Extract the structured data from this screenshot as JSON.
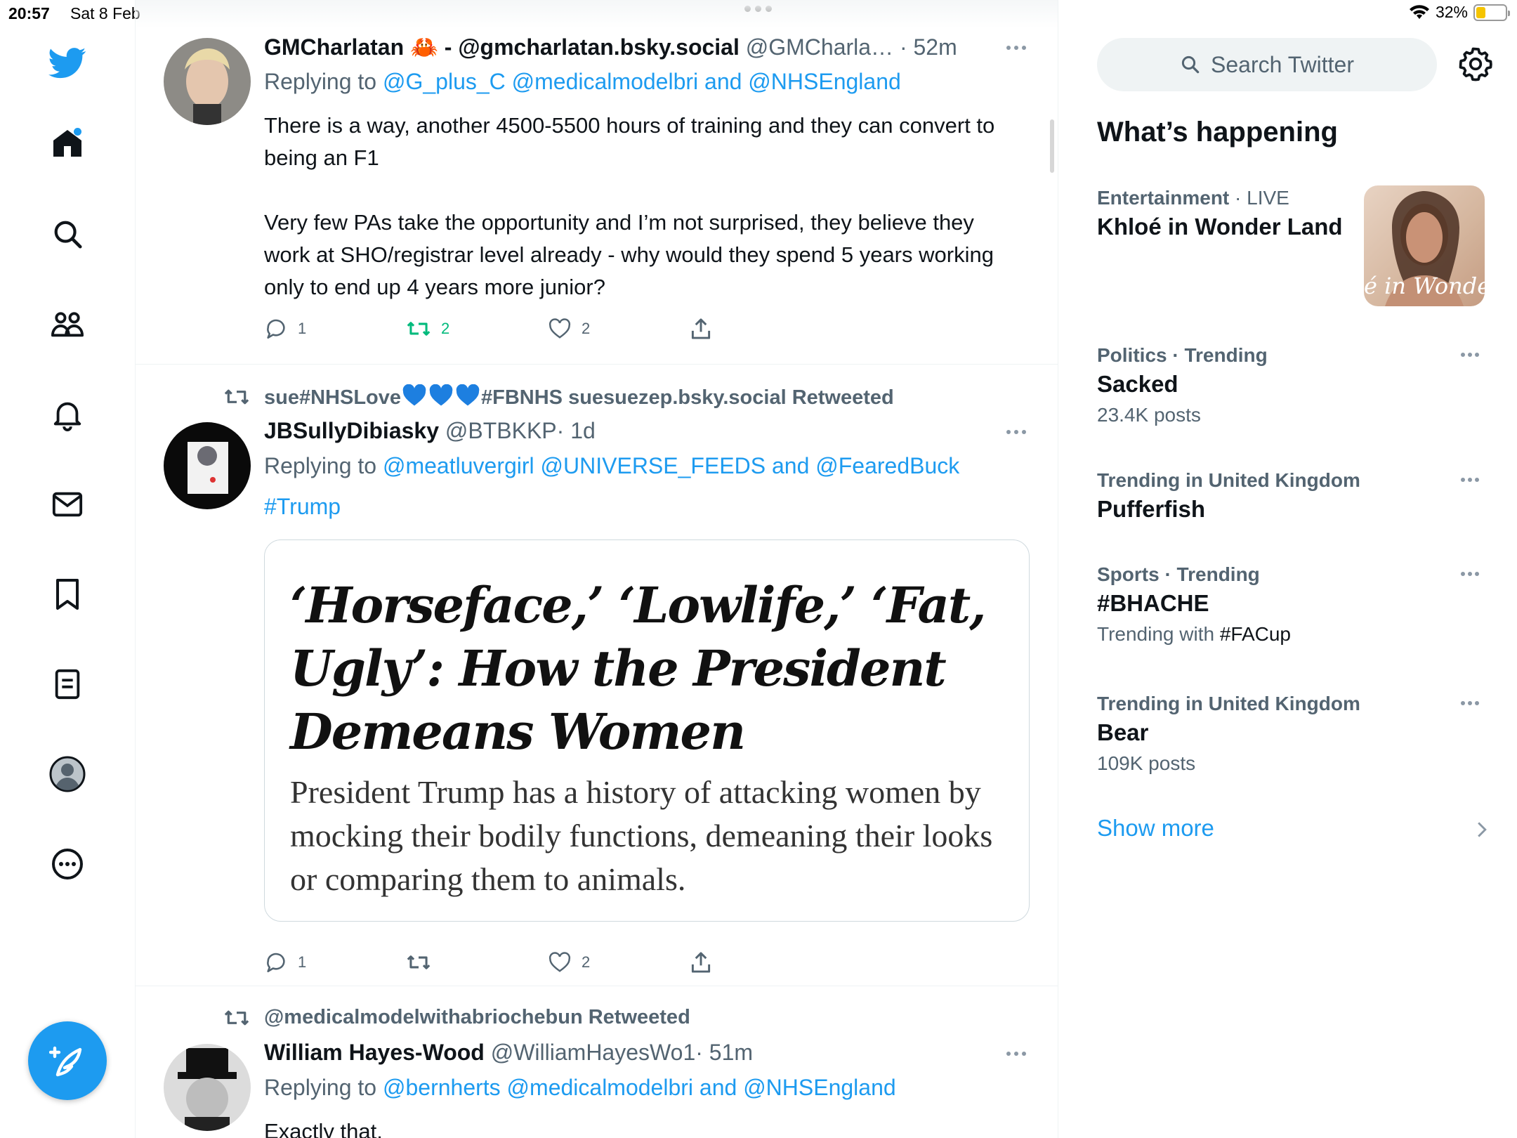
{
  "status_bar": {
    "time": "20:57",
    "date": "Sat 8 Feb",
    "battery": "32%",
    "battery_level": 0.32
  },
  "colors": {
    "accent": "#1d9bf0",
    "retweet_active": "#00ba7c",
    "muted": "#536471",
    "text": "#0f1419"
  },
  "nav": {
    "icons": [
      "twitter-logo",
      "home-icon",
      "search-icon",
      "communities-icon",
      "notifications-icon",
      "messages-icon",
      "bookmarks-icon",
      "lists-icon",
      "profile-icon",
      "more-icon"
    ],
    "compose_icon": "compose-icon"
  },
  "tweets": [
    {
      "name": "GMCharlatan 🦀 - @gmcharlatan.bsky.social",
      "handle": "@GMCharla…",
      "time": "· 52m",
      "reply_prefix": "Replying to",
      "reply_to": "@G_plus_C @medicalmodelbri and @NHSEngland",
      "paragraphs": [
        "There is a way, another 4500-5500 hours of training and they can convert to being an F1",
        "Very few PAs take the opportunity and I’m not surprised, they believe they work at SHO/registrar level already - why would they spend 5 years working only to end up 4 years more junior?"
      ],
      "stats": {
        "replies": "1",
        "retweets": "2",
        "likes": "2"
      }
    },
    {
      "retweeted_by": "sue#NHSLove",
      "retweeted_suffix": "#FBNHS suesuezep.bsky.social Retweeted",
      "name": "JBSullyDibiasky",
      "handle": "@BTBKKP",
      "time": "· 1d",
      "reply_prefix": "Replying to",
      "reply_to": "@meatluvergirl @UNIVERSE_FEEDS and @FearedBuck",
      "hashtag": "#Trump",
      "card": {
        "title": "‘Horseface,’ ‘Lowlife,’ ‘Fat, Ugly’: How the President Demeans Women",
        "description": "President Trump has a history of attacking women by mocking their bodily functions, demeaning their looks or comparing them to animals."
      },
      "stats": {
        "replies": "1",
        "retweets": "",
        "likes": "2"
      }
    },
    {
      "retweeted_by": "@medicalmodelwithabriochebun Retweeted",
      "name": "William Hayes-Wood",
      "handle": "@WilliamHayesWo1",
      "time": "· 51m",
      "reply_prefix": "Replying to",
      "reply_to": "@bernherts @medicalmodelbri and @NHSEngland",
      "text": "Exactly that."
    }
  ],
  "sidebar": {
    "search_placeholder": "Search Twitter",
    "title": "What’s happening",
    "trends": [
      {
        "category": "Entertainment",
        "live": "· LIVE",
        "name": "Khloé in Wonder Land",
        "image_text": "é in Wonder l"
      },
      {
        "category": "Politics · Trending",
        "name": "Sacked",
        "posts": "23.4K posts"
      },
      {
        "category": "Trending in United Kingdom",
        "name": "Pufferfish"
      },
      {
        "category": "Sports · Trending",
        "name": "#BHACHE",
        "with_prefix": "Trending with",
        "with_tag": "#FACup"
      },
      {
        "category": "Trending in United Kingdom",
        "name": "Bear",
        "posts": "109K posts"
      }
    ],
    "show_more": "Show more"
  }
}
